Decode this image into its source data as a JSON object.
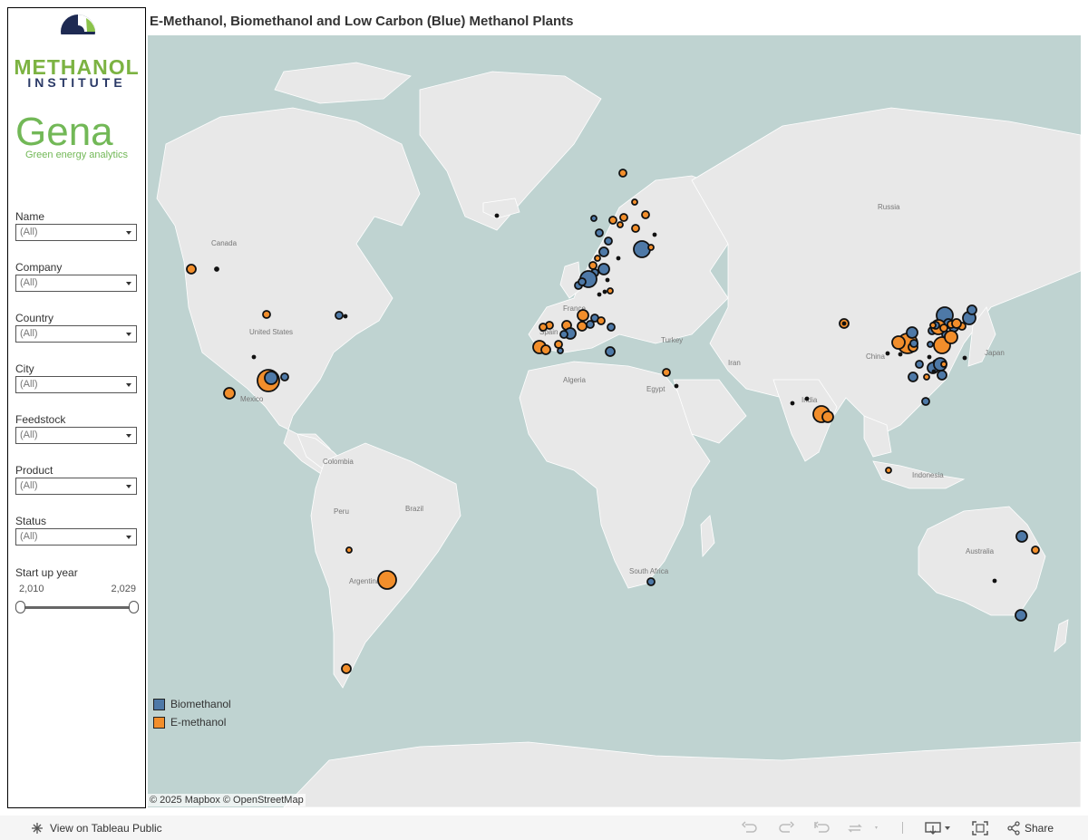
{
  "title": "E-Methanol, Biomethanol and Low Carbon (Blue) Methanol Plants",
  "logos": {
    "methanol_institute_line1": "METHANOL",
    "methanol_institute_line2": "INSTITUTE",
    "gena": "Gena",
    "gena_tagline": "Green energy analytics"
  },
  "filters": [
    {
      "label": "Name",
      "value": "(All)"
    },
    {
      "label": "Company",
      "value": "(All)"
    },
    {
      "label": "Country",
      "value": "(All)"
    },
    {
      "label": "City",
      "value": "(All)"
    },
    {
      "label": "Feedstock",
      "value": "(All)"
    },
    {
      "label": "Product",
      "value": "(All)"
    },
    {
      "label": "Status",
      "value": "(All)"
    }
  ],
  "start_year": {
    "label": "Start up year",
    "min": "2,010",
    "max": "2,029"
  },
  "legend": [
    {
      "label": "Biomethanol",
      "color": "#4e79a7"
    },
    {
      "label": "E-methanol",
      "color": "#f28e2b"
    }
  ],
  "colors": {
    "biomethanol": "#4e79a7",
    "emethanol": "#f28e2b",
    "low_carbon": "#111111",
    "ocean": "#bfd3d1",
    "land": "#e8e8e8"
  },
  "map_labels": [
    "Canada",
    "United States",
    "Mexico",
    "Colombia",
    "Brazil",
    "Peru",
    "Argentina",
    "Russia",
    "Turkey",
    "Iran",
    "Algeria",
    "Egypt",
    "India",
    "China",
    "Japan",
    "Indonesia",
    "Australia",
    "South Africa",
    "France",
    "Spain"
  ],
  "attribution": "© 2025 Mapbox  © OpenStreetMap",
  "footer": {
    "view_link": "View on Tableau Public",
    "share": "Share"
  }
}
